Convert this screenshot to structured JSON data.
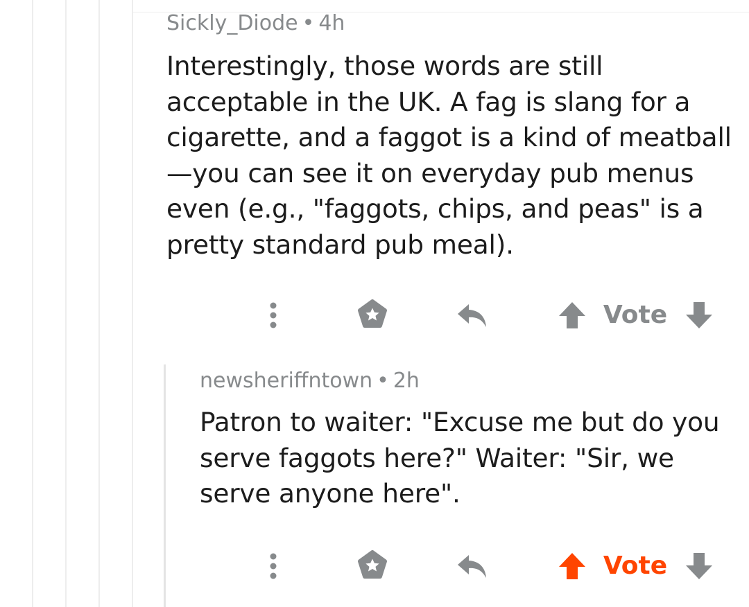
{
  "comments": [
    {
      "author": "Sickly_Diode",
      "separator": "•",
      "age": "4h",
      "body": "Interestingly, those words are still acceptable in the UK. A fag is slang for a cigarette, and a faggot is a kind of meatball—you can see it on everyday pub menus even (e.g., \"faggots, chips, and peas\" is a pretty standard pub meal).",
      "vote_label": "Vote",
      "upvoted": false
    },
    {
      "author": "newsheriffntown",
      "separator": "•",
      "age": "2h",
      "body": "Patron to waiter: \"Excuse me but do you serve faggots here?\" Waiter: \"Sir, we serve anyone here\".",
      "vote_label": "Vote",
      "upvoted": true
    }
  ],
  "colors": {
    "upvote_active": "#ff4500",
    "icon_gray": "#878a8c",
    "thread_line": "#ededed"
  },
  "icons": [
    "more-vertical-icon",
    "award-icon",
    "reply-icon",
    "upvote-arrow-icon",
    "downvote-arrow-icon"
  ]
}
